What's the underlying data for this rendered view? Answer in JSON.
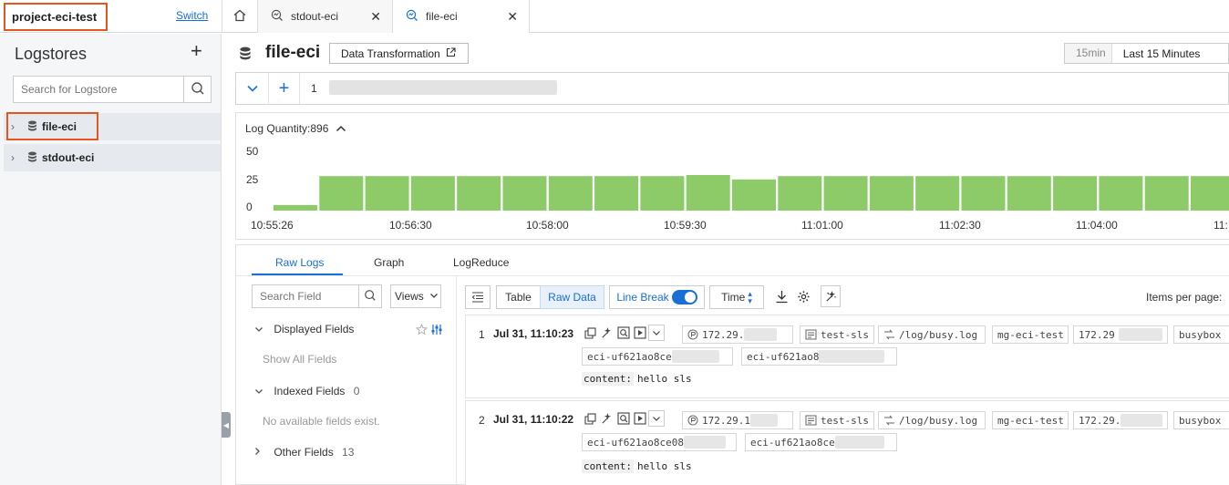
{
  "topbar": {
    "project_name": "project-eci-test",
    "switch_label": "Switch",
    "tabs": [
      {
        "label": "stdout-eci"
      },
      {
        "label": "file-eci"
      }
    ]
  },
  "sidebar": {
    "title": "Logstores",
    "search_placeholder": "Search for Logstore",
    "items": [
      {
        "label": "file-eci"
      },
      {
        "label": "stdout-eci"
      }
    ]
  },
  "header": {
    "title": "file-eci",
    "data_transformation_label": "Data Transformation",
    "time_quick": "15min",
    "time_range": "Last 15 Minutes"
  },
  "query": {
    "line_number": "1"
  },
  "histogram": {
    "title": "Log Quantity:896",
    "y_ticks": [
      "50",
      "25",
      "0"
    ],
    "x_ticks": [
      "10:55:26",
      "10:56:30",
      "10:58:00",
      "10:59:30",
      "11:01:00",
      "11:02:30",
      "11:04:00",
      "11:"
    ],
    "bar_heights": [
      5,
      31,
      31,
      31,
      31,
      31,
      31,
      31,
      31,
      32,
      28,
      31,
      31,
      31,
      31,
      31,
      31,
      31,
      31,
      31,
      31
    ]
  },
  "results": {
    "tabs": [
      "Raw Logs",
      "Graph",
      "LogReduce"
    ],
    "field_search_placeholder": "Search Field",
    "views_label": "Views",
    "displayed_fields_label": "Displayed Fields",
    "show_all_fields": "Show All Fields",
    "indexed_fields_label": "Indexed Fields",
    "indexed_fields_count": "0",
    "no_fields_note": "No available fields exist.",
    "other_fields_label": "Other Fields",
    "other_fields_count": "13",
    "toolbar": {
      "table_label": "Table",
      "raw_data_label": "Raw Data",
      "line_break_label": "Line Break",
      "time_label": "Time",
      "items_per_page_label": "Items per page:"
    },
    "logs": [
      {
        "index": "1",
        "time": "Jul 31, 11:10:23",
        "ip": "172.29.",
        "topic": "test-sls",
        "path": "/log/busy.log",
        "group": "mg-eci-test",
        "ip2": "172.29",
        "container": "busybox",
        "pod1": "eci-uf621ao8ce",
        "pod2": "eci-uf621ao8",
        "content_key": "content:",
        "content_value": "hello sls"
      },
      {
        "index": "2",
        "time": "Jul 31, 11:10:22",
        "ip": "172.29.1",
        "topic": "test-sls",
        "path": "/log/busy.log",
        "group": "mg-eci-test",
        "ip2": "172.29.",
        "container": "busybox",
        "pod1": "eci-uf621ao8ce08",
        "pod2": "eci-uf621ao8ce",
        "content_key": "content:",
        "content_value": "hello sls"
      }
    ]
  },
  "colors": {
    "accent": "#1a6fd5",
    "highlight_box": "#e8541f",
    "bar": "#8dcb69"
  }
}
